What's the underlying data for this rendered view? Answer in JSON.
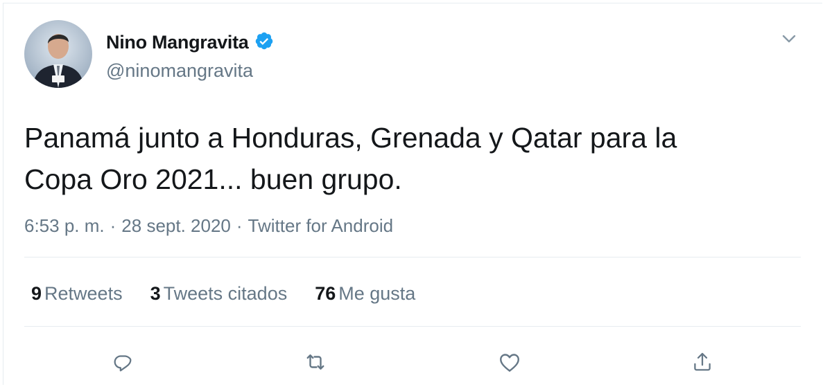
{
  "tweet": {
    "author_name": "Nino Mangravita",
    "handle": "@ninomangravita",
    "verified": true,
    "text_line1": "Panamá junto a Honduras, Grenada y Qatar para la",
    "text_line2": "Copa Oro 2021... buen grupo.",
    "time": "6:53 p. m.",
    "sep1": "·",
    "date": "28 sept. 2020",
    "sep2": "·",
    "source": "Twitter for Android"
  },
  "stats": {
    "retweets_count": "9",
    "retweets_label": "Retweets",
    "quotes_count": "3",
    "quotes_label": "Tweets citados",
    "likes_count": "76",
    "likes_label": "Me gusta"
  },
  "colors": {
    "verified_blue": "#1da1f2",
    "secondary_text": "#657786",
    "primary_text": "#14171a",
    "divider": "#e6ecf0"
  },
  "icons": {
    "verified": "verified-badge-icon",
    "caret": "chevron-down-icon",
    "reply": "reply-icon",
    "retweet": "retweet-icon",
    "like": "heart-icon",
    "share": "share-icon"
  }
}
